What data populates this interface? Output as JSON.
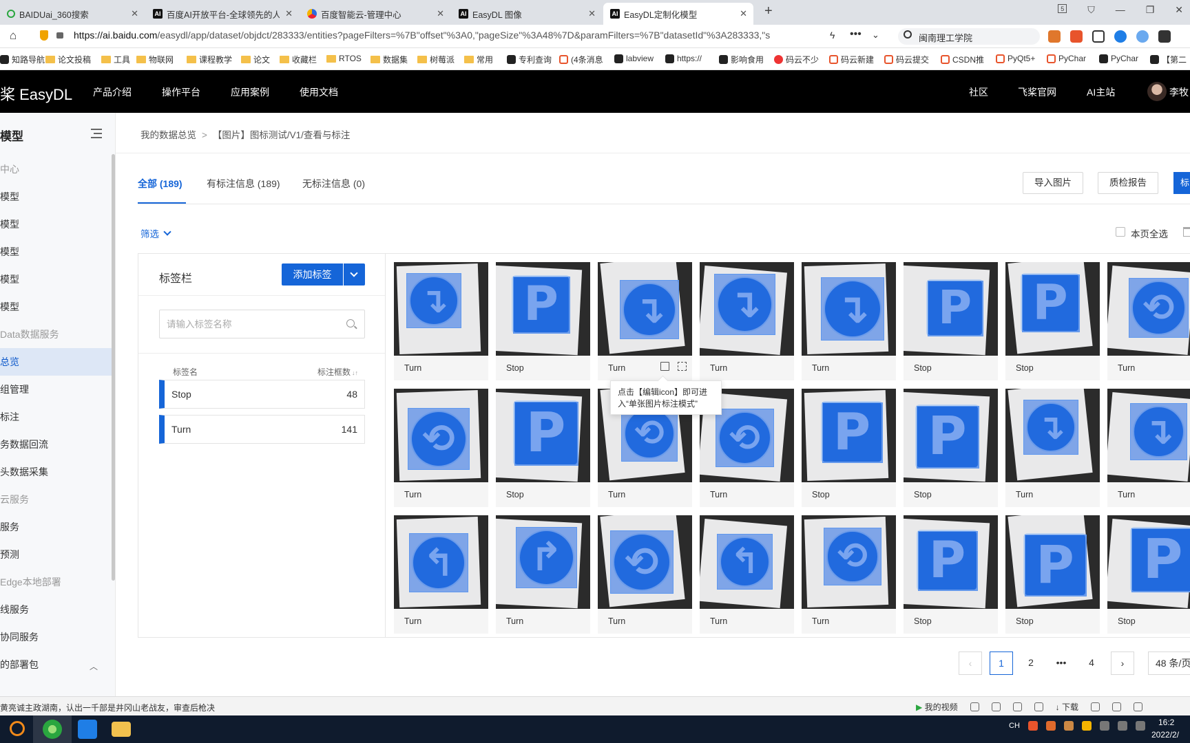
{
  "browser": {
    "tabs": [
      {
        "label": "BAIDUai_360搜索",
        "favicon": "o",
        "active": false
      },
      {
        "label": "百度AI开放平台-全球领先的人",
        "favicon": "AI",
        "active": false
      },
      {
        "label": "百度智能云-管理中心",
        "favicon": "cloud",
        "active": false
      },
      {
        "label": "EasyDL 图像",
        "favicon": "AI",
        "active": false
      },
      {
        "label": "EasyDL定制化模型",
        "favicon": "AI",
        "active": true
      }
    ],
    "close_glyph": "✕",
    "new_tab_glyph": "+",
    "window_badge": "5",
    "url_host": "https://ai.baidu.com",
    "url_path": "/easydl/app/dataset/objdct/283333/entities?pageFilters=%7B\"offset\"%3A0,\"pageSize\"%3A48%7D&paramFilters=%7B\"datasetId\"%3A283333,\"s",
    "search_text": "闽南理工学院",
    "bookmarks": [
      {
        "label": "知路导航",
        "icon": "bico"
      },
      {
        "label": "论文投稿",
        "icon": "fold"
      },
      {
        "label": "工具",
        "icon": "fold"
      },
      {
        "label": "物联网",
        "icon": "fold"
      },
      {
        "label": "课程教学",
        "icon": "fold"
      },
      {
        "label": "论文",
        "icon": "fold"
      },
      {
        "label": "收藏栏",
        "icon": "fold"
      },
      {
        "label": "RTOS",
        "icon": "fold"
      },
      {
        "label": "数据集",
        "icon": "fold"
      },
      {
        "label": "树莓派",
        "icon": "fold"
      },
      {
        "label": "常用",
        "icon": "fold"
      },
      {
        "label": "专利查询",
        "icon": "bico"
      },
      {
        "label": "(4条消息",
        "icon": "cico"
      },
      {
        "label": "labview",
        "icon": "bico"
      },
      {
        "label": "https://",
        "icon": "bico"
      },
      {
        "label": "影响食用",
        "icon": "bico"
      },
      {
        "label": "码云不少",
        "icon": "gico"
      },
      {
        "label": "码云新建",
        "icon": "cico"
      },
      {
        "label": "码云提交",
        "icon": "cico"
      },
      {
        "label": "CSDN推",
        "icon": "cico"
      },
      {
        "label": "PyQt5+",
        "icon": "cico"
      },
      {
        "label": "PyChar",
        "icon": "cico"
      },
      {
        "label": "PyChar",
        "icon": "bico"
      },
      {
        "label": "【第二",
        "icon": "bico"
      }
    ]
  },
  "header": {
    "logo": "桨 EasyDL",
    "nav": [
      "产品介绍",
      "操作平台",
      "应用案例",
      "使用文档"
    ],
    "right_nav": [
      "社区",
      "飞桨官网",
      "AI主站"
    ],
    "user": "李牧"
  },
  "sidebar": {
    "title": "模型",
    "items": [
      {
        "label": "中心",
        "type": "group"
      },
      {
        "label": "模型",
        "type": "item"
      },
      {
        "label": "模型",
        "type": "item"
      },
      {
        "label": "模型",
        "type": "item"
      },
      {
        "label": "模型",
        "type": "item"
      },
      {
        "label": "模型",
        "type": "item"
      },
      {
        "label": "Data数据服务",
        "type": "group"
      },
      {
        "label": "总览",
        "type": "selected"
      },
      {
        "label": "组管理",
        "type": "item"
      },
      {
        "label": "标注",
        "type": "item"
      },
      {
        "label": "务数据回流",
        "type": "item"
      },
      {
        "label": "头数据采集",
        "type": "item"
      },
      {
        "label": "云服务",
        "type": "group"
      },
      {
        "label": "服务",
        "type": "item"
      },
      {
        "label": "预测",
        "type": "item"
      },
      {
        "label": "Edge本地部署",
        "type": "group"
      },
      {
        "label": "线服务",
        "type": "item"
      },
      {
        "label": "协同服务",
        "type": "item"
      },
      {
        "label": "的部署包",
        "type": "item"
      }
    ]
  },
  "breadcrumb": {
    "root": "我的数据总览",
    "sep": ">",
    "current": "【图片】图标测试/V1/查看与标注"
  },
  "data_tabs": [
    "全部 (189)",
    "有标注信息 (189)",
    "无标注信息 (0)"
  ],
  "actions": {
    "import": "导入图片",
    "qc_report": "质检报告",
    "cut_edge": "标"
  },
  "filter_label": "筛选",
  "select_all_label": "本页全选",
  "label_panel": {
    "title": "标签栏",
    "add_button": "添加标签",
    "search_placeholder": "请输入标签名称",
    "col_name": "标签名",
    "col_count": "标注框数",
    "sort_glyph": "↓↑",
    "labels": [
      {
        "name": "Stop",
        "count": "48"
      },
      {
        "name": "Turn",
        "count": "141"
      }
    ]
  },
  "images": [
    {
      "label": "Turn",
      "kind": "turn"
    },
    {
      "label": "Stop",
      "kind": "park"
    },
    {
      "label": "Turn",
      "kind": "turn"
    },
    {
      "label": "Turn",
      "kind": "turn"
    },
    {
      "label": "Turn",
      "kind": "turn"
    },
    {
      "label": "Stop",
      "kind": "park"
    },
    {
      "label": "Stop",
      "kind": "park"
    },
    {
      "label": "Turn",
      "kind": "round"
    },
    {
      "label": "Turn",
      "kind": "round"
    },
    {
      "label": "Stop",
      "kind": "park"
    },
    {
      "label": "Turn",
      "kind": "round"
    },
    {
      "label": "Turn",
      "kind": "round"
    },
    {
      "label": "Stop",
      "kind": "park"
    },
    {
      "label": "Stop",
      "kind": "park"
    },
    {
      "label": "Turn",
      "kind": "turn"
    },
    {
      "label": "Turn",
      "kind": "turn"
    },
    {
      "label": "Turn",
      "kind": "left"
    },
    {
      "label": "Turn",
      "kind": "right"
    },
    {
      "label": "Turn",
      "kind": "round"
    },
    {
      "label": "Turn",
      "kind": "left"
    },
    {
      "label": "Turn",
      "kind": "round"
    },
    {
      "label": "Stop",
      "kind": "park"
    },
    {
      "label": "Stop",
      "kind": "park"
    },
    {
      "label": "Stop",
      "kind": "park"
    }
  ],
  "tooltip": "点击【编辑icon】即可进入“单张图片标注模式”",
  "pagination": {
    "pages": [
      "1",
      "2",
      "•••",
      "4"
    ],
    "current": "1",
    "page_size": "48 条/页"
  },
  "status": {
    "text": "黄亮诚主政湖南，认出一千部是井冈山老战友，审查后枪决",
    "video": "我的视频",
    "download": "下载"
  },
  "taskbar": {
    "tray_lang": "CH",
    "time": "16:2",
    "date": "2022/2/"
  },
  "colors": {
    "brand_blue": "#1565d8",
    "sign_blue": "#1a67d6",
    "header_bg": "#000000"
  }
}
